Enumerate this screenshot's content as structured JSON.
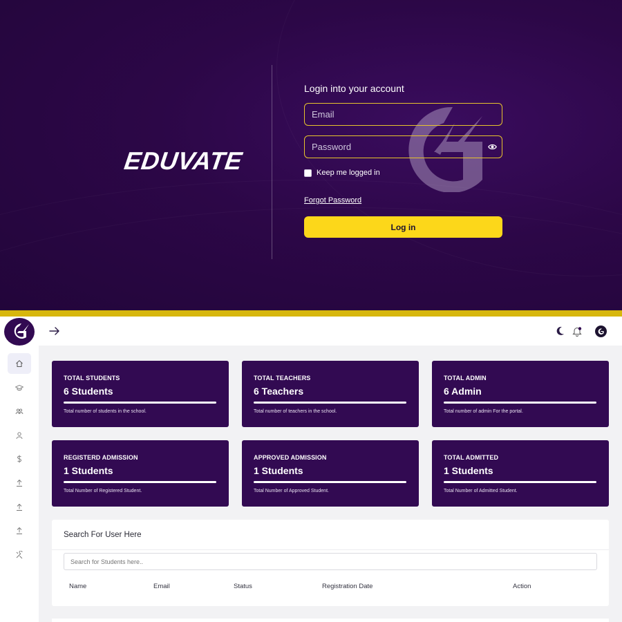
{
  "login": {
    "brand": "EDUVATE",
    "title": "Login into your account",
    "email_placeholder": "Email",
    "password_placeholder": "Password",
    "keep_logged_in": "Keep me logged in",
    "forgot_password": "Forgot Password",
    "login_button": "Log in"
  },
  "colors": {
    "login_bg": "#2c0747",
    "accent_yellow": "#fcd71a",
    "card_bg": "#320a52"
  },
  "icons": {
    "topbar": [
      "logo-icon",
      "arrow-right-icon",
      "moon-icon",
      "bell-icon",
      "avatar-icon"
    ],
    "sidebar": [
      "home-icon",
      "graduation-cap-icon",
      "group-icon",
      "user-icon",
      "dollar-icon",
      "upload-icon",
      "upload-icon",
      "upload-icon",
      "tools-icon"
    ]
  },
  "cards": [
    {
      "title": "TOTAL STUDENTS",
      "value": "6 Students",
      "desc": "Total number of students in the school."
    },
    {
      "title": "TOTAL TEACHERS",
      "value": "6 Teachers",
      "desc": "Total number of teachers in the school."
    },
    {
      "title": "TOTAL ADMIN",
      "value": "6 Admin",
      "desc": "Total number of admin For the portal."
    },
    {
      "title": "REGISTERD ADMISSION",
      "value": "1 Students",
      "desc": "Total Number of Registered Student."
    },
    {
      "title": "APPROVED ADMISSION",
      "value": "1 Students",
      "desc": "Total Number of Approved Student."
    },
    {
      "title": "TOTAL ADMITTED",
      "value": "1 Students",
      "desc": "Total Number of Admitted Student."
    }
  ],
  "search": {
    "title": "Search For User Here",
    "placeholder": "Search for Students here.."
  },
  "table": {
    "columns": [
      "Name",
      "Email",
      "Status",
      "Registration Date",
      "Action"
    ]
  }
}
